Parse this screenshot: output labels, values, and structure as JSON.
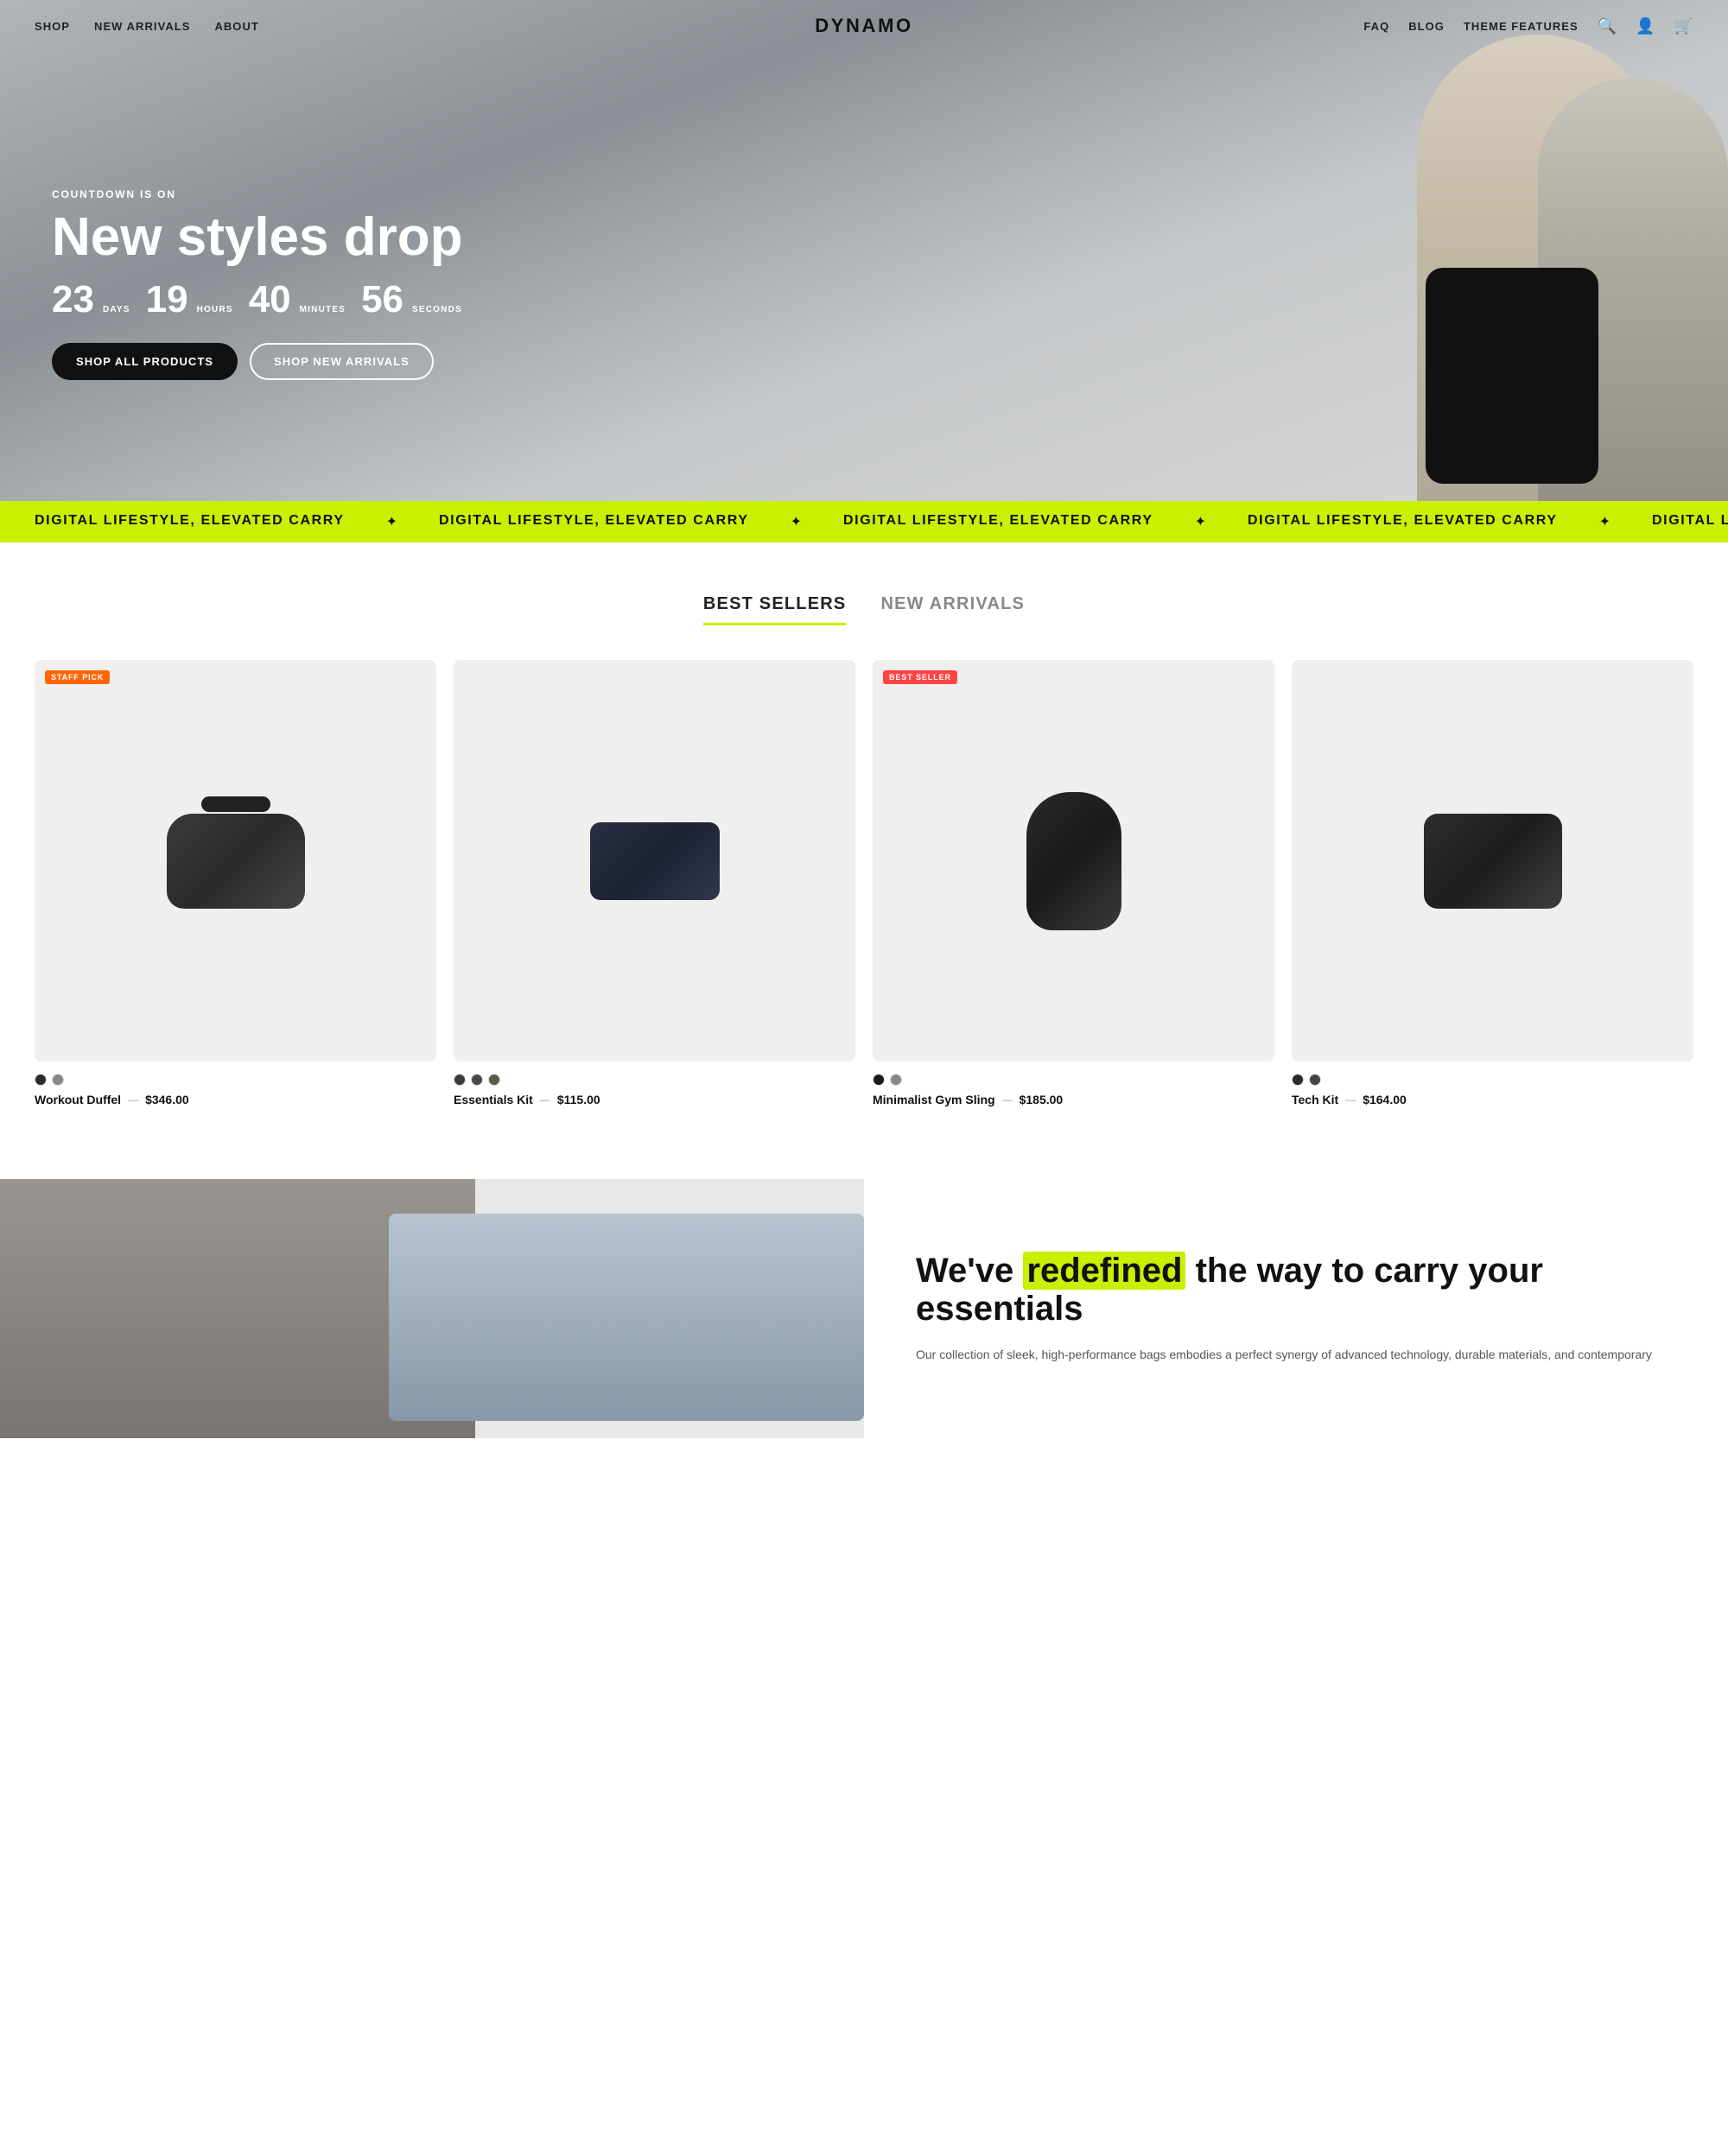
{
  "nav": {
    "left_links": [
      {
        "label": "SHOP",
        "href": "#"
      },
      {
        "label": "NEW ARRIVALS",
        "href": "#"
      },
      {
        "label": "ABOUT",
        "href": "#"
      }
    ],
    "logo": "DYNAMO",
    "right_links": [
      {
        "label": "FAQ",
        "href": "#"
      },
      {
        "label": "BLOG",
        "href": "#"
      },
      {
        "label": "THEME FEATURES",
        "href": "#"
      }
    ]
  },
  "hero": {
    "eyebrow": "COUNTDOWN IS ON",
    "title": "New styles drop",
    "countdown": {
      "days_num": "23",
      "days_label": "DAYS",
      "hours_num": "19",
      "hours_label": "HOURS",
      "minutes_num": "40",
      "minutes_label": "MINUTES",
      "seconds_num": "56",
      "seconds_label": "SECONDS"
    },
    "btn_primary": "SHOP ALL PRODUCTS",
    "btn_secondary": "SHOP NEW ARRIVALS"
  },
  "marquee": {
    "text": "DIGITAL LIFESTYLE, ELEVATED CARRY"
  },
  "products_section": {
    "tabs": [
      {
        "label": "BEST SELLERS",
        "active": true
      },
      {
        "label": "NEW ARRIVALS",
        "active": false
      }
    ],
    "products": [
      {
        "name": "Workout Duffel",
        "price": "$346.00",
        "badge": "STAFF PICK",
        "badge_type": "staff",
        "colors": [
          "#2a2a2a",
          "#888888"
        ],
        "bag_type": "duffel"
      },
      {
        "name": "Essentials Kit",
        "price": "$115.00",
        "badge": null,
        "colors": [
          "#3a3a3a",
          "#4a4a4a",
          "#5a5a45"
        ],
        "bag_type": "kit"
      },
      {
        "name": "Minimalist Gym Sling",
        "price": "$185.00",
        "badge": "BEST SELLER",
        "badge_type": "bestseller",
        "colors": [
          "#1a1a1a",
          "#888888"
        ],
        "bag_type": "sling"
      },
      {
        "name": "Tech Kit",
        "price": "$164.00",
        "badge": null,
        "colors": [
          "#2a2a2a",
          "#444444"
        ],
        "bag_type": "tech"
      }
    ]
  },
  "redefined": {
    "title_part1": "We've",
    "title_highlight": "redefined",
    "title_part2": "the way to carry your essentials",
    "description": "Our collection of sleek, high-performance bags embodies a perfect synergy of advanced technology, durable materials, and contemporary"
  }
}
